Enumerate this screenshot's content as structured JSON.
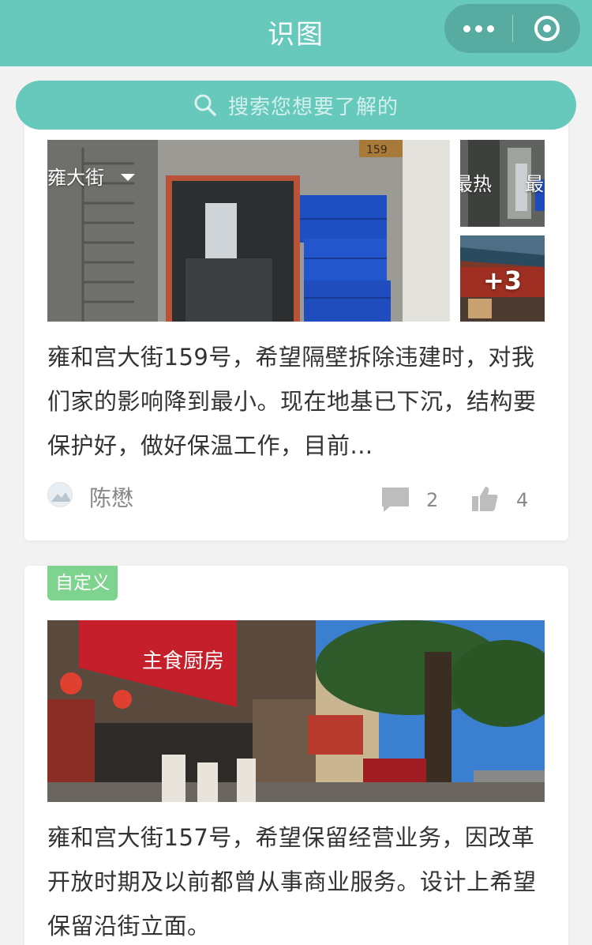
{
  "navbar": {
    "title": "识图"
  },
  "search": {
    "placeholder": "搜索您想要了解的"
  },
  "posts": [
    {
      "filter_label": "雍大街",
      "hot_label": "最热",
      "newest_label": "最",
      "more_count": "+3",
      "house_number_plate": "159",
      "description": "雍和宫大街159号，希望隔壁拆除违建时，对我们家的影响降到最小。现在地基已下沉，结构要保护好，做好保温工作，目前...",
      "author": "陈懋",
      "comment_count": "2",
      "like_count": "4"
    },
    {
      "tag": "自定义",
      "shop_sign": "主食厨房",
      "description": "雍和宫大街157号，希望保留经营业务，因改革开放时期及以前都曾从事商业服务。设计上希望保留沿街立面。"
    }
  ],
  "colors": {
    "brand": "#67c8bc",
    "tag": "#7ed38f"
  },
  "icons": [
    "more-dots-icon",
    "close-capsule-icon",
    "search-icon",
    "caret-down-icon",
    "comment-icon",
    "thumbs-up-icon"
  ]
}
